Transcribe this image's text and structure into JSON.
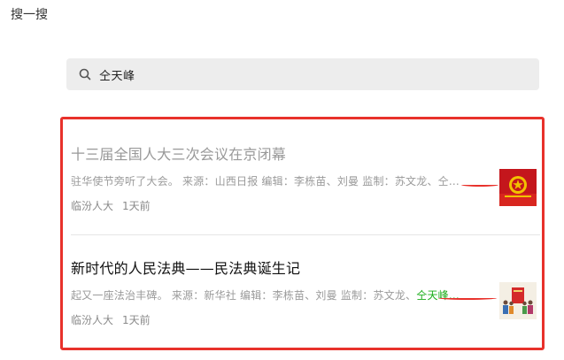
{
  "header": {
    "title": "搜一搜"
  },
  "search": {
    "query": "仝天峰"
  },
  "results": [
    {
      "title": "十三届全国人大三次会议在京闭幕",
      "visited": true,
      "snippet_pre": "驻华使节旁听了大会。 来源：山西日报 编辑：李栋苗、刘曼 监制：苏文龙、",
      "snippet_hl": "仝...",
      "source": "临汾人大",
      "time": "1天前",
      "thumbnail": "national-emblem-icon"
    },
    {
      "title": "新时代的人民法典——民法典诞生记",
      "visited": false,
      "snippet_pre": "起又一座法治丰碑。 来源：新华社 编辑：李栋苗、刘曼 监制：苏文龙、",
      "snippet_hl": "仝天峰...",
      "source": "临汾人大",
      "time": "1天前",
      "thumbnail": "civil-code-cover-icon"
    }
  ],
  "colors": {
    "highlight": "#1aad19",
    "annotation_red": "#e8312b",
    "search_bg": "#ededed"
  }
}
